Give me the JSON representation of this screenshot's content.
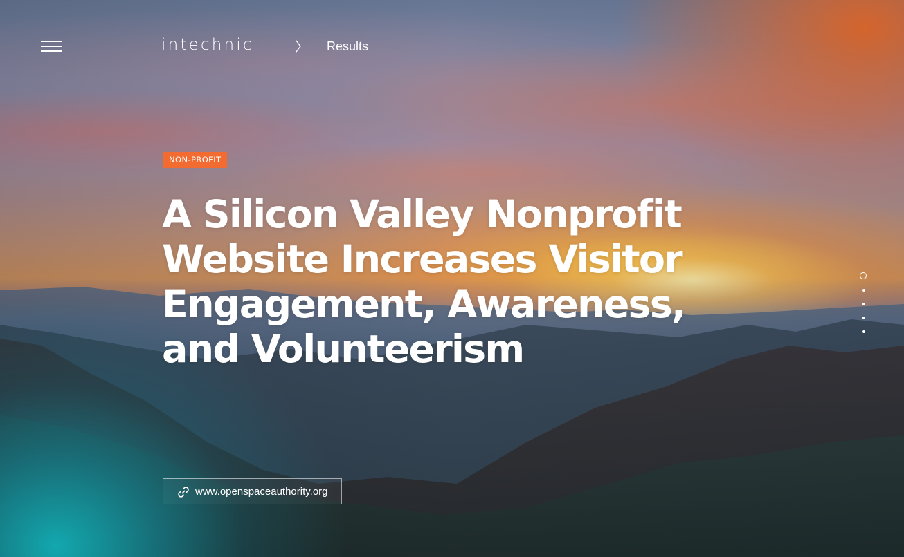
{
  "header": {
    "logo_text": "intechnic",
    "breadcrumb_separator_icon": "chevron-right-icon",
    "breadcrumb_label": "Results",
    "menu_icon": "hamburger-menu-icon"
  },
  "hero": {
    "category_tag": "NON-PROFIT",
    "title": "A Silicon Valley Nonprofit Website Increases Visitor Engagement, Awareness, and Volunteerism",
    "website_link": {
      "icon": "link-icon",
      "label": "www.openspaceauthority.org"
    }
  },
  "slide_nav": {
    "total": 5,
    "active_index": 0
  },
  "colors": {
    "tag_background": "#f26b31",
    "text": "#ffffff",
    "accent_teal": "#14cdd2"
  }
}
